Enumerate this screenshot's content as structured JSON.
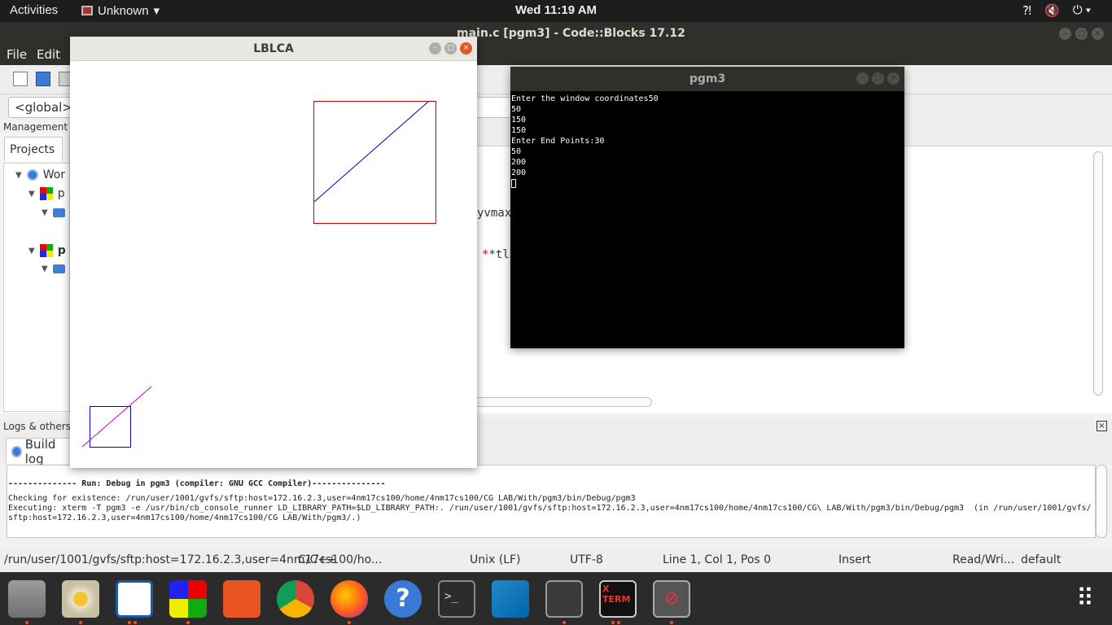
{
  "topbar": {
    "activities": "Activities",
    "app_name": "Unknown",
    "clock": "Wed 11:19 AM"
  },
  "codeblocks": {
    "title": "main.c [pgm3] - Code::Blocks 17.12",
    "menu": [
      "File",
      "Edit"
    ],
    "scope_select": "<global>",
    "management_label": "Management",
    "projects_tab": "Projects",
    "tree": [
      {
        "label": "Wor"
      },
      {
        "label": "p"
      },
      {
        "label": "p"
      }
    ],
    "editor_fragment_1": "yvmax=",
    "editor_fragment_2": "*tl,",
    "logs_label": "Logs & others",
    "build_log_tab": "Build log",
    "log_lines": [
      "-------------- Run: Debug in pgm3 (compiler: GNU GCC Compiler)---------------",
      "Checking for existence: /run/user/1001/gvfs/sftp:host=172.16.2.3,user=4nm17cs100/home/4nm17cs100/CG LAB/With/pgm3/bin/Debug/pgm3",
      "Executing: xterm -T pgm3 -e /usr/bin/cb_console_runner LD_LIBRARY_PATH=$LD_LIBRARY_PATH:. /run/user/1001/gvfs/sftp:host=172.16.2.3,user=4nm17cs100/home/4nm17cs100/CG\\ LAB/With/pgm3/bin/Debug/pgm3  (in /run/user/1001/gvfs/",
      "sftp:host=172.16.2.3,user=4nm17cs100/home/4nm17cs100/CG LAB/With/pgm3/.)"
    ],
    "statusbar": {
      "path": "/run/user/1001/gvfs/sftp:host=172.16.2.3,user=4nm17cs100/ho...",
      "lang": "C/C++",
      "eol": "Unix (LF)",
      "encoding": "UTF-8",
      "position": "Line 1, Col 1, Pos 0",
      "mode": "Insert",
      "access": "Read/Wri...",
      "profile": "default"
    }
  },
  "lblca": {
    "title": "LBLCA"
  },
  "pgm3": {
    "title": "pgm3",
    "terminal_lines": [
      "Enter the window coordinates50",
      "50",
      "150",
      "150",
      "Enter End Points:30",
      "50",
      "200",
      "200"
    ]
  },
  "colors": {
    "clip_window_original": "#cc0000",
    "line_original": "#0000cc",
    "clip_window_small": "#0000cc",
    "line_small": "#cc00cc",
    "accent": "#e95420"
  },
  "dock": {
    "icons": [
      "files-icon",
      "rhythmbox-icon",
      "writer-icon",
      "codeblocks-icon",
      "software-icon",
      "chrome-icon",
      "firefox-icon",
      "help-icon",
      "terminal-icon",
      "vscode-icon",
      "system-monitor-icon",
      "xterm-icon",
      "blocked-app-icon",
      "app-grid-icon"
    ]
  }
}
